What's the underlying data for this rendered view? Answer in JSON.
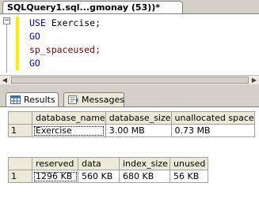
{
  "document_tab": {
    "title": "SQLQuery1.sql...gmonay (53))*"
  },
  "editor": {
    "lines": [
      {
        "kw": "USE",
        "rest": "Exercise;"
      },
      {
        "kw": "GO"
      },
      {
        "proc": "sp_spaceused;"
      },
      {
        "kw": "GO"
      }
    ]
  },
  "results_tabs": [
    {
      "label": "Results",
      "icon": "results-grid-icon",
      "active": true
    },
    {
      "label": "Messages",
      "icon": "messages-icon",
      "active": false
    }
  ],
  "result_sets": [
    {
      "columns": [
        "database_name",
        "database_size",
        "unallocated space"
      ],
      "rows": [
        {
          "num": "1",
          "cells": [
            "Exercise",
            "3.00 MB",
            "0.73 MB"
          ]
        }
      ]
    },
    {
      "columns": [
        "reserved",
        "data",
        "index_size",
        "unused"
      ],
      "rows": [
        {
          "num": "1",
          "cells": [
            "1296 KB",
            "560 KB",
            "680 KB",
            "56 KB"
          ]
        }
      ]
    }
  ],
  "colors": {
    "keyword": "#0000ff",
    "procedure": "#800000",
    "change_bar": "#ffed00",
    "header_bg": "#ece9d8"
  }
}
